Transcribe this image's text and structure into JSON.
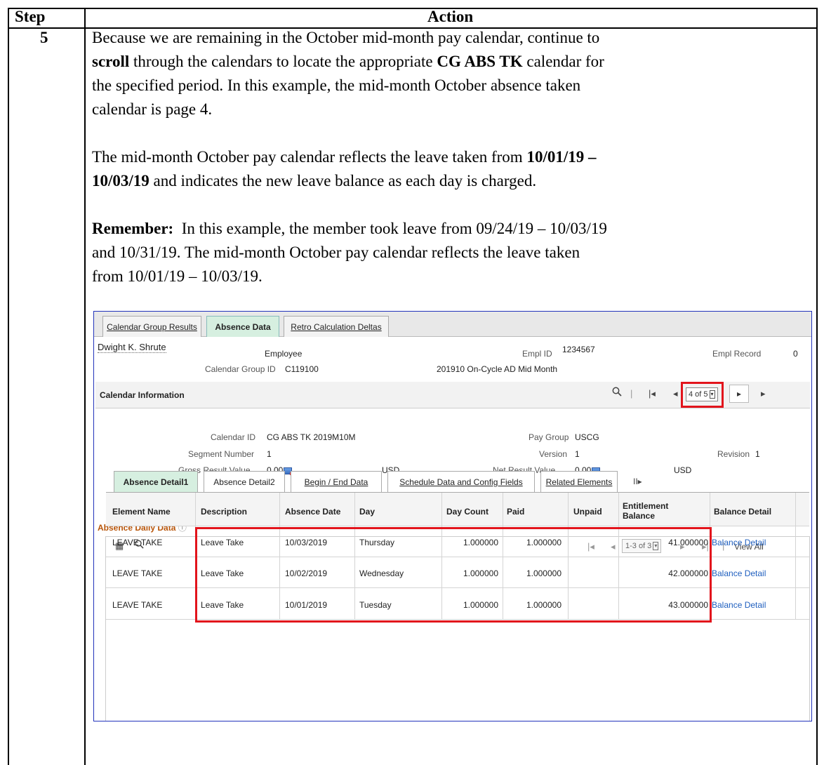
{
  "doc": {
    "header_step": "Step",
    "header_action": "Action",
    "step_number": "5",
    "para1": {
      "t1": "Because we are remaining in the October mid-month pay calendar, continue to",
      "b1": "scroll",
      "t2": " through the calendars to locate the appropriate ",
      "b2": "CG ABS TK",
      "t3": " calendar for",
      "t4": "the specified period.  In this example, the mid-month October absence taken",
      "t5": "calendar is page 4."
    },
    "para2": {
      "t1": "The mid-month October pay calendar reflects the leave taken from ",
      "b1": "10/01/19 –",
      "b2": "10/03/19",
      "t2": " and indicates the new leave balance as each day is charged."
    },
    "para3": {
      "b1": "Remember:",
      "t1": "  In this example, the member took leave from 09/24/19 – 10/03/19",
      "t2": "and 10/31/19.  The mid-month October pay calendar reflects the leave taken",
      "t3": "from 10/01/19 – 10/03/19."
    }
  },
  "screen": {
    "tabs": [
      "Calendar Group Results",
      "Absence Data",
      "Retro Calculation Deltas"
    ],
    "employee_name": "Dwight K. Shrute",
    "employee_label": "Employee",
    "empl_id_label": "Empl ID",
    "empl_id": "1234567",
    "empl_record_label": "Empl Record",
    "empl_record": "0",
    "cal_group_id_label": "Calendar Group ID",
    "cal_group_id": "C119100",
    "cal_group_desc": "201910 On-Cycle AD Mid Month",
    "cal_info_title": "Calendar Information",
    "pager_value": "4 of 5",
    "calendar_id_label": "Calendar ID",
    "calendar_id": "CG ABS TK 2019M10M",
    "pay_group_label": "Pay Group",
    "pay_group": "USCG",
    "segment_label": "Segment Number",
    "segment": "1",
    "version_label": "Version",
    "version": "1",
    "revision_label": "Revision",
    "revision": "1",
    "gross_label": "Gross Result Value",
    "gross_value": "0.00",
    "gross_currency": "USD",
    "net_label": "Net Result Value",
    "net_value": "0.00",
    "net_currency": "USD",
    "absence_title": "Absence Daily Data",
    "grid_pager": "1-3 of 3",
    "view_all": "View All",
    "subtabs": [
      "Absence Detail1",
      "Absence Detail2",
      "Begin / End Data",
      "Schedule Data and Config Fields",
      "Related Elements"
    ],
    "more_tabs": "II▸",
    "columns": [
      "Element Name",
      "Description",
      "Absence Date",
      "Day",
      "Day Count",
      "Paid",
      "Unpaid",
      "Entitlement Balance",
      "Balance Detail"
    ],
    "rows": [
      [
        "LEAVE TAKE",
        "Leave Take",
        "10/03/2019",
        "Thursday",
        "1.000000",
        "1.000000",
        "",
        "41.000000",
        "Balance Detail"
      ],
      [
        "LEAVE TAKE",
        "Leave Take",
        "10/02/2019",
        "Wednesday",
        "1.000000",
        "1.000000",
        "",
        "42.000000",
        "Balance Detail"
      ],
      [
        "LEAVE TAKE",
        "Leave Take",
        "10/01/2019",
        "Tuesday",
        "1.000000",
        "1.000000",
        "",
        "43.000000",
        "Balance Detail"
      ]
    ],
    "highlight_color": "#e2141c",
    "link_color": "#1f5fbf",
    "active_tab_color": "#d6efe0"
  }
}
